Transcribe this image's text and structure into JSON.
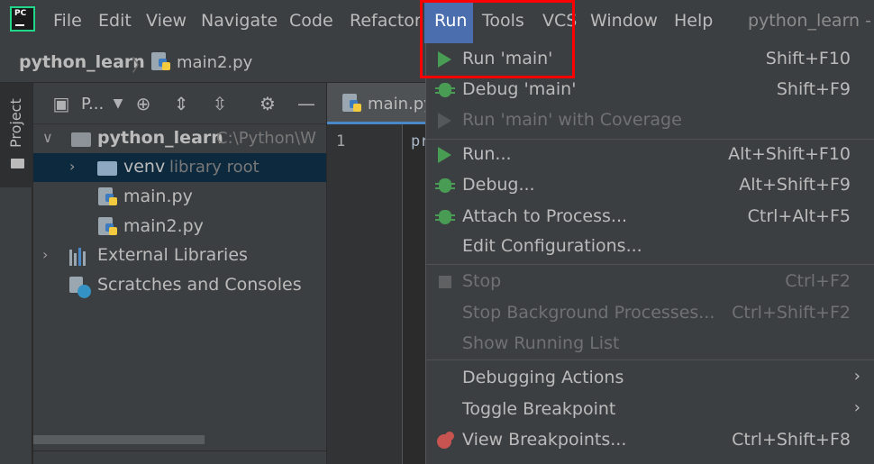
{
  "app": {
    "logo_text": "PC",
    "window_title": "python_learn - m"
  },
  "menubar": {
    "items": [
      "File",
      "Edit",
      "View",
      "Navigate",
      "Code",
      "Refactor",
      "Run",
      "Tools",
      "VCS",
      "Window",
      "Help"
    ],
    "active": "Run"
  },
  "breadcrumb": {
    "project": "python_learn",
    "separator": "〉",
    "file": "main2.py"
  },
  "toolstrip": {
    "project_tab": "Project"
  },
  "project_panel": {
    "title": "P...",
    "tree": [
      {
        "label": "python_learn",
        "hint": "C:\\Python\\W"
      },
      {
        "label": "venv",
        "hint": "library root"
      },
      {
        "label": "main.py"
      },
      {
        "label": "main2.py"
      },
      {
        "label": "External Libraries"
      },
      {
        "label": "Scratches and Consoles"
      }
    ]
  },
  "editor": {
    "tab": "main.py",
    "line_number": "1",
    "code_start": "pr"
  },
  "run_menu": {
    "items": [
      {
        "label": "Run 'main'",
        "shortcut": "Shift+F10",
        "icon": "run-icon",
        "enabled": true
      },
      {
        "label": "Debug 'main'",
        "shortcut": "Shift+F9",
        "icon": "debug-icon",
        "enabled": true
      },
      {
        "label": "Run 'main' with Coverage",
        "shortcut": "",
        "icon": "coverage-icon",
        "enabled": false
      },
      {
        "label": "Run...",
        "shortcut": "Alt+Shift+F10",
        "icon": "run-icon",
        "enabled": true
      },
      {
        "label": "Debug...",
        "shortcut": "Alt+Shift+F9",
        "icon": "debug-icon",
        "enabled": true
      },
      {
        "label": "Attach to Process...",
        "shortcut": "Ctrl+Alt+F5",
        "icon": "attach-icon",
        "enabled": true
      },
      {
        "label": "Edit Configurations...",
        "shortcut": "",
        "icon": "",
        "enabled": true
      },
      {
        "label": "Stop",
        "shortcut": "Ctrl+F2",
        "icon": "stop-icon",
        "enabled": false
      },
      {
        "label": "Stop Background Processes...",
        "shortcut": "Ctrl+Shift+F2",
        "icon": "",
        "enabled": false
      },
      {
        "label": "Show Running List",
        "shortcut": "",
        "icon": "",
        "enabled": false
      },
      {
        "label": "Debugging Actions",
        "shortcut": "",
        "icon": "",
        "enabled": true,
        "submenu": true
      },
      {
        "label": "Toggle Breakpoint",
        "shortcut": "",
        "icon": "",
        "enabled": true,
        "submenu": true
      },
      {
        "label": "View Breakpoints...",
        "shortcut": "Ctrl+Shift+F8",
        "icon": "breakpoints-icon",
        "enabled": true
      }
    ]
  },
  "colors": {
    "menu_bg": "#3c3f41",
    "editor_bg": "#2b2b2b",
    "selection": "#4b6eaf",
    "tree_selection": "#0d293e",
    "run_green": "#499c54",
    "highlight_red": "#ff0000"
  }
}
